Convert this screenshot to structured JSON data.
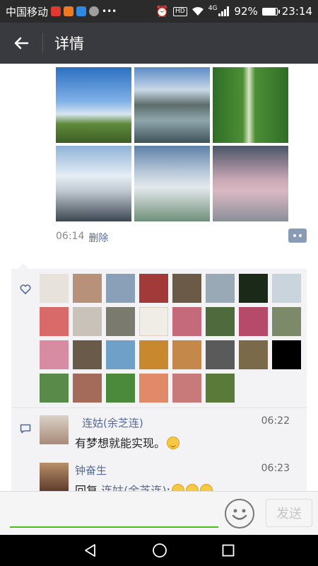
{
  "status_bar": {
    "carrier": "中国移动",
    "hd": "HD",
    "network": "4G",
    "battery_percent": "92%",
    "battery_level": 0.92,
    "time": "23:14"
  },
  "header": {
    "title": "详情"
  },
  "post": {
    "time": "06:14",
    "delete_label": "删除"
  },
  "comments": [
    {
      "name": "连姑(余芝连)",
      "time": "06:22",
      "text": "有梦想就能实现。"
    },
    {
      "name": "钟奋生",
      "time": "06:23",
      "reply_prefix": "回复 ",
      "reply_to": "连姑(余芝连)",
      "reply_suffix": ":"
    }
  ],
  "input": {
    "send_label": "发送"
  },
  "colors": {
    "link": "#576b95",
    "accent_green": "#45c01a",
    "title_bar": "#393a3f"
  }
}
